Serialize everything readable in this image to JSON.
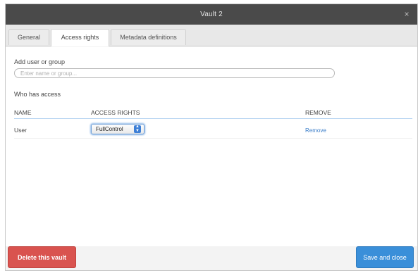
{
  "window": {
    "title": "Vault 2",
    "close_glyph": "×"
  },
  "tabs": [
    {
      "label": "General"
    },
    {
      "label": "Access rights",
      "active": true
    },
    {
      "label": "Metadata definitions"
    }
  ],
  "add_section": {
    "label": "Add user or group",
    "search_placeholder": "Enter name or group..."
  },
  "access_section": {
    "label": "Who has access",
    "columns": {
      "name": "NAME",
      "rights": "ACCESS RIGHTS",
      "remove": "REMOVE"
    },
    "rows": [
      {
        "name": "User",
        "access_right": "FullControl",
        "remove_label": "Remove"
      }
    ]
  },
  "footer": {
    "delete_label": "Delete this vault",
    "save_label": "Save and close"
  },
  "colors": {
    "delete_button": "#d9534f",
    "save_button": "#3a8fd9",
    "link": "#3b7ec9",
    "titlebar": "#4a4a4a"
  }
}
